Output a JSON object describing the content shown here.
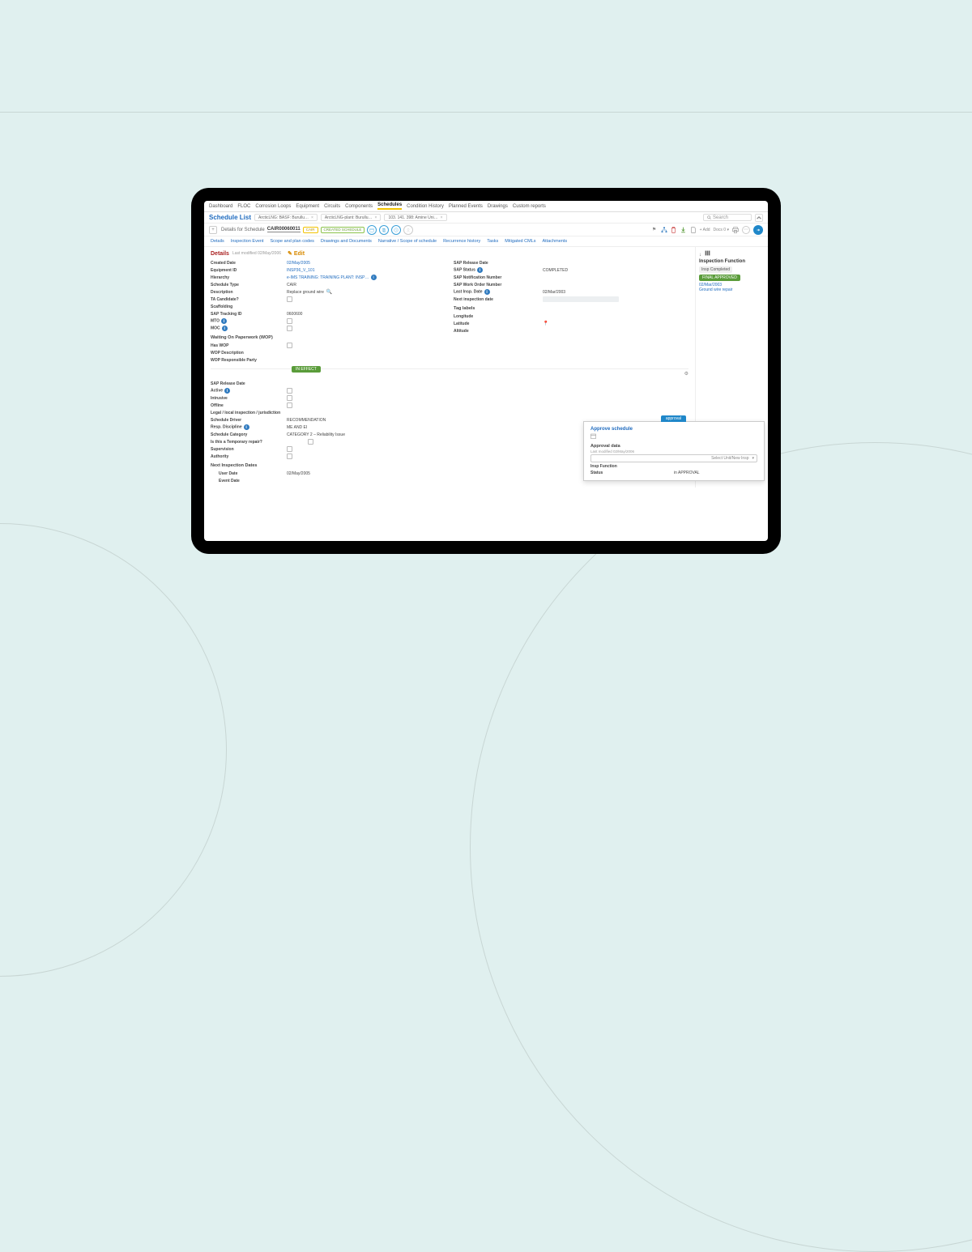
{
  "nav": {
    "items": [
      "Dashboard",
      "FLOC",
      "Corrosion Loops",
      "Equipment",
      "Circuits",
      "Components",
      "Schedules",
      "Condition History",
      "Planned Events",
      "Drawings",
      "Custom reports"
    ],
    "active": "Schedules"
  },
  "titlebar": {
    "title": "Schedule List",
    "crumbs": [
      "ArcticLNG: BASF: Burullu…",
      "ArcticLNG-plant: Burullu…",
      "103. 141. 398: Amine Uni…"
    ],
    "search_placeholder": "Search"
  },
  "schedule": {
    "details_for": "Details for Schedule",
    "id": "CAIR00060011",
    "chip1": "CAIR",
    "chip2": "CREATED SCHEDULE",
    "toolbar": {
      "add": "Add",
      "docs": "Docs"
    }
  },
  "subtabs": [
    "Details",
    "Inspection Event",
    "Scope and plan codes",
    "Drawings and Documents",
    "Narrative / Scope of schedule",
    "Recurrence history",
    "Tasks",
    "Mitigated CMLs",
    "Attachments"
  ],
  "details": {
    "title": "Details",
    "last_modified": "Last modified 02/May/2006",
    "edit": "Edit",
    "left": [
      {
        "label": "Created Date",
        "value": "02/May/2005",
        "link": true
      },
      {
        "label": "Equipment ID",
        "value": "INSP36_V_101",
        "link": true
      },
      {
        "label": "Hierarchy",
        "value": "e-IMS TRAINING: TRAINING PLANT: INSP…",
        "link": true,
        "info": true
      },
      {
        "label": "Schedule Type",
        "value": "CAIR"
      },
      {
        "label": "Description",
        "value": "Replace ground wire",
        "magnify": true
      },
      {
        "label": "TA Candidate?",
        "checkbox": true
      },
      {
        "label": "Scaffolding",
        "value": ""
      },
      {
        "label": "SAP Tracking ID",
        "value": "0600600"
      },
      {
        "label": "MTO",
        "checkbox": true,
        "info": true
      },
      {
        "label": "MOC",
        "checkbox": true,
        "info": true
      }
    ],
    "wop_title": "Waiting On Paperwork (WOP)",
    "wop": [
      {
        "label": "Has WOP",
        "checkbox": true
      },
      {
        "label": "WOP Description",
        "value": ""
      },
      {
        "label": "WOP Responsible Party",
        "value": ""
      }
    ],
    "right": [
      {
        "label": "SAP Release Date",
        "value": ""
      },
      {
        "label": "SAP Status",
        "value": "COMPLETED",
        "info": true
      },
      {
        "label": "SAP Notification Number",
        "value": ""
      },
      {
        "label": "SAP Work Order Number",
        "value": ""
      },
      {
        "label": "Last Insp. Date",
        "value": "02/Mar/2003",
        "info": true
      },
      {
        "label": "Next inspection date",
        "greybox": true
      }
    ],
    "tag_title": "Tag labels",
    "tags": [
      {
        "label": "Longitude",
        "value": ""
      },
      {
        "label": "Latitude",
        "pin": true
      },
      {
        "label": "Altitude",
        "value": ""
      }
    ]
  },
  "right_panel": {
    "title": "Inspection Function",
    "status": "Insp Completed",
    "badge": "FINAL APPROVED",
    "date": "02/Mar/2003",
    "desc": "Ground wire repair"
  },
  "divider_tag": "IN EFFECT",
  "lower": {
    "rows": [
      {
        "label": "SAP Release Date",
        "value": ""
      },
      {
        "label": "Active",
        "checkbox": true,
        "info": true
      },
      {
        "label": "Intrusive",
        "checkbox": true
      },
      {
        "label": "Offline",
        "checkbox": true
      },
      {
        "label": "Legal / local inspection / jurisdiction",
        "checkbox": true
      },
      {
        "label": "Schedule Driver",
        "value": "RECOMMENDATION"
      },
      {
        "label": "Resp. Discipline",
        "value": "ME AND EI",
        "info": true
      },
      {
        "label": "Schedule Category",
        "value": "CATEGORY 2 – Reliability Issue"
      },
      {
        "label": "Is this a Temporary repair?",
        "checkbox": true
      },
      {
        "label": "Supervision",
        "checkbox": true
      },
      {
        "label": "Authority",
        "checkbox": true
      }
    ],
    "nid_title": "Next Inspection Dates",
    "nid": [
      {
        "label": "User Date",
        "value": "02/May/2005"
      },
      {
        "label": "Event Date",
        "value": ""
      }
    ]
  },
  "popup": {
    "tab": "approval",
    "t1": "Approve schedule",
    "t2": "Approval data",
    "mod": "Last modified 02/May/2006",
    "select": "Select Unit/New Insp",
    "rows": [
      {
        "l": "Insp Function",
        "r": ""
      },
      {
        "l": "Status",
        "r": "in APPROVAL"
      }
    ]
  }
}
